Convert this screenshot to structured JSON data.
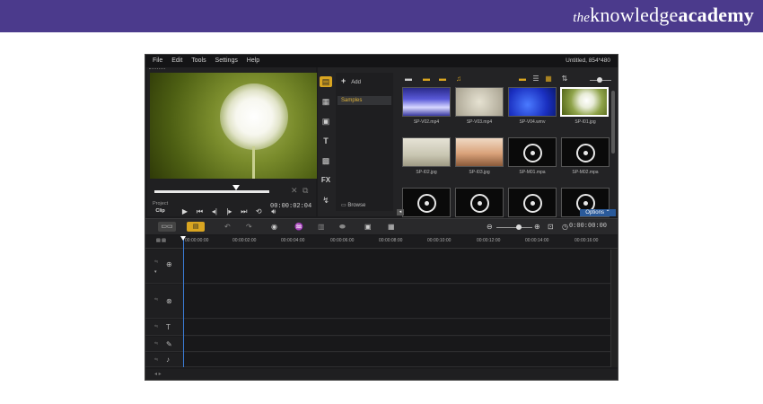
{
  "brand": {
    "prefix": "the",
    "word1": "knowledge",
    "word2": "academy"
  },
  "window": {
    "project_name": "Untitled, 854*480"
  },
  "menu": [
    {
      "label": "File"
    },
    {
      "label": "Edit"
    },
    {
      "label": "Tools"
    },
    {
      "label": "Settings"
    },
    {
      "label": "Help"
    }
  ],
  "player": {
    "mode_project": "Project",
    "mode_clip": "Clip",
    "timecode": "00:00:02:04"
  },
  "library": {
    "add_label": "Add",
    "folders": [
      "Samples"
    ],
    "browse_label": "Browse",
    "options_label": "Options",
    "media": [
      {
        "name": "SP-V02.mp4",
        "kind": "video",
        "color": "#3a3aa0"
      },
      {
        "name": "SP-V03.mp4",
        "kind": "video",
        "color": "#c8c2b0"
      },
      {
        "name": "SP-V04.wmv",
        "kind": "video",
        "color": "#1f3fd0"
      },
      {
        "name": "SP-I01.jpg",
        "kind": "image",
        "color": "#8fa34a"
      },
      {
        "name": "SP-I02.jpg",
        "kind": "image",
        "color": "#c9c6b2"
      },
      {
        "name": "SP-I03.jpg",
        "kind": "image",
        "color": "#c98b62"
      },
      {
        "name": "SP-M01.mpa",
        "kind": "audio",
        "color": "#0a0a0a"
      },
      {
        "name": "SP-M02.mpa",
        "kind": "audio",
        "color": "#0a0a0a"
      }
    ]
  },
  "timeline": {
    "timecode": "0:00:00:00",
    "ruler": [
      "00:00:00:00",
      "00:00:02:00",
      "00:00:04:00",
      "00:00:06:00",
      "00:00:08:00",
      "00:00:10:00",
      "00:00:12:00",
      "00:00:14:00",
      "00:00:16:00"
    ]
  },
  "colors": {
    "accent": "#d9a521",
    "banner": "#4b3a8c",
    "options": "#2a5a9a"
  }
}
